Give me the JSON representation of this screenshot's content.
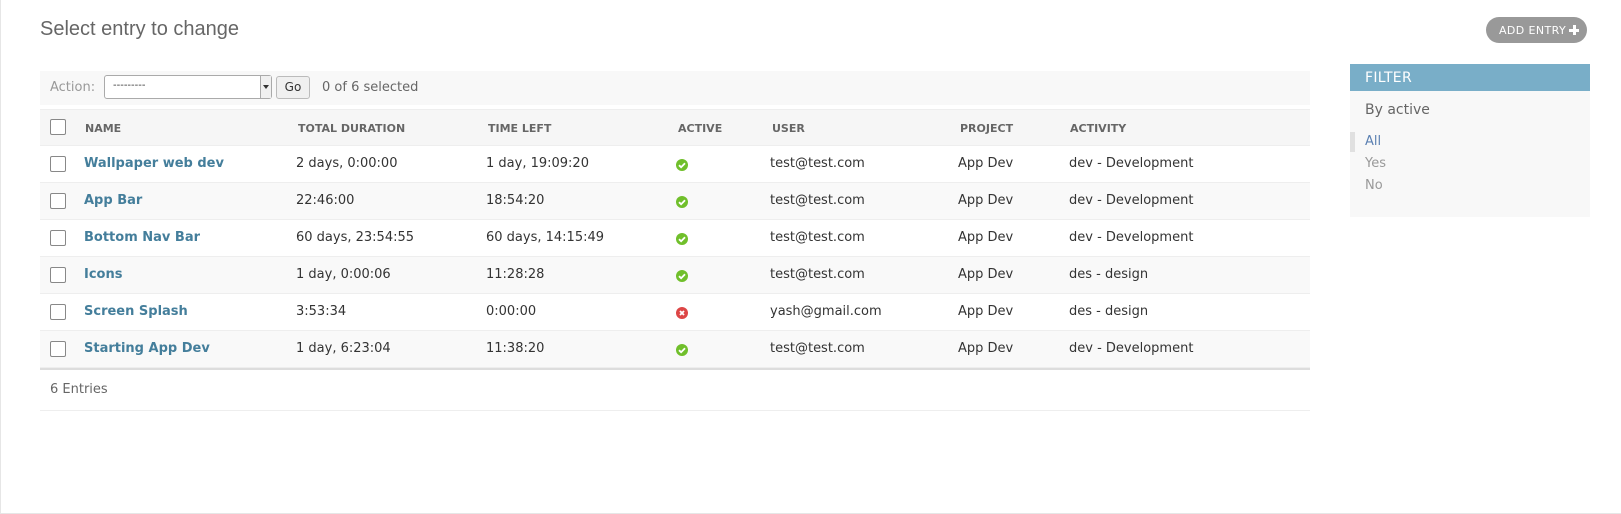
{
  "header": {
    "title": "Select entry to change",
    "add_button": "ADD ENTRY"
  },
  "actions": {
    "label": "Action:",
    "select_value": "---------",
    "go_label": "Go",
    "selected_text": "0 of 6 selected"
  },
  "table": {
    "columns": [
      "NAME",
      "TOTAL DURATION",
      "TIME LEFT",
      "ACTIVE",
      "USER",
      "PROJECT",
      "ACTIVITY"
    ],
    "rows": [
      {
        "name": "Wallpaper web dev",
        "total_duration": "2 days, 0:00:00",
        "time_left": "1 day, 19:09:20",
        "active": true,
        "user": "test@test.com",
        "project": "App Dev",
        "activity": "dev - Development"
      },
      {
        "name": "App Bar",
        "total_duration": "22:46:00",
        "time_left": "18:54:20",
        "active": true,
        "user": "test@test.com",
        "project": "App Dev",
        "activity": "dev - Development"
      },
      {
        "name": "Bottom Nav Bar",
        "total_duration": "60 days, 23:54:55",
        "time_left": "60 days, 14:15:49",
        "active": true,
        "user": "test@test.com",
        "project": "App Dev",
        "activity": "dev - Development"
      },
      {
        "name": "Icons",
        "total_duration": "1 day, 0:00:06",
        "time_left": "11:28:28",
        "active": true,
        "user": "test@test.com",
        "project": "App Dev",
        "activity": "des - design"
      },
      {
        "name": "Screen Splash",
        "total_duration": "3:53:34",
        "time_left": "0:00:00",
        "active": false,
        "user": "yash@gmail.com",
        "project": "App Dev",
        "activity": "des - design"
      },
      {
        "name": "Starting App Dev",
        "total_duration": "1 day, 6:23:04",
        "time_left": "11:38:20",
        "active": true,
        "user": "test@test.com",
        "project": "App Dev",
        "activity": "dev - Development"
      }
    ]
  },
  "paginator": {
    "count_text": "6 Entries"
  },
  "filter": {
    "title": "FILTER",
    "by_label": "By active",
    "options": [
      "All",
      "Yes",
      "No"
    ],
    "selected": "All"
  },
  "icons": {
    "active_true": "check-circle-icon",
    "active_false": "x-circle-icon",
    "add": "plus-icon"
  },
  "colors": {
    "link": "#447e9b",
    "filter_header": "#79aec8",
    "active_yes": "#70bf2b",
    "active_no": "#dd4646"
  }
}
